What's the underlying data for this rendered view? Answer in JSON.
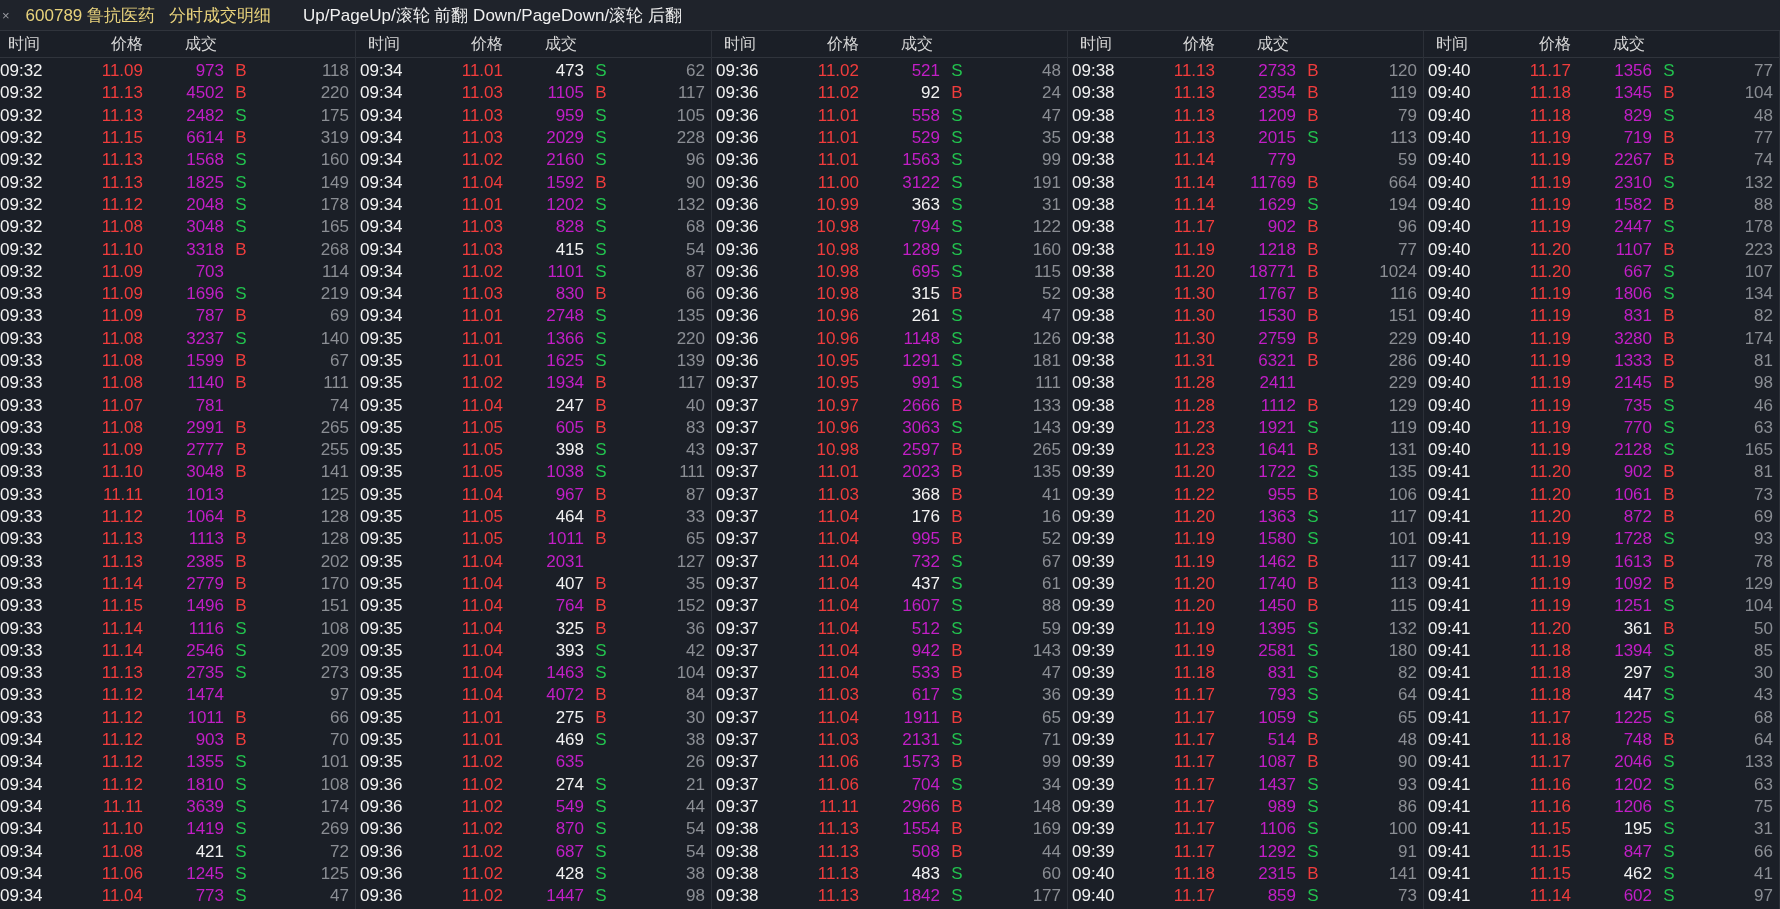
{
  "title_bar": {
    "close": "×",
    "stock": "600789 鲁抗医药",
    "view": "分时成交明细",
    "hint": "Up/PageUp/滚轮 前翻 Down/PageDown/滚轮 后翻"
  },
  "groups": [
    {
      "columns": [
        "时间",
        "价格",
        "成交"
      ],
      "rows": [
        {
          "time": "09:32",
          "price": "11.09",
          "volume": "973",
          "big": true,
          "side": "B",
          "kind": "buy",
          "count": "118"
        },
        {
          "time": "09:32",
          "price": "11.13",
          "volume": "4502",
          "big": true,
          "side": "B",
          "kind": "buy",
          "count": "220"
        },
        {
          "time": "09:32",
          "price": "11.13",
          "volume": "2482",
          "big": true,
          "side": "S",
          "kind": "sell",
          "count": "175"
        },
        {
          "time": "09:32",
          "price": "11.15",
          "volume": "6614",
          "big": true,
          "side": "B",
          "kind": "buy",
          "count": "319"
        },
        {
          "time": "09:32",
          "price": "11.13",
          "volume": "1568",
          "big": true,
          "side": "S",
          "kind": "sell",
          "count": "160"
        },
        {
          "time": "09:32",
          "price": "11.13",
          "volume": "1825",
          "big": true,
          "side": "S",
          "kind": "sell",
          "count": "149"
        },
        {
          "time": "09:32",
          "price": "11.12",
          "volume": "2048",
          "big": true,
          "side": "S",
          "kind": "sell",
          "count": "178"
        },
        {
          "time": "09:32",
          "price": "11.08",
          "volume": "3048",
          "big": true,
          "side": "S",
          "kind": "sell",
          "count": "165"
        },
        {
          "time": "09:32",
          "price": "11.10",
          "volume": "3318",
          "big": true,
          "side": "B",
          "kind": "buy",
          "count": "268"
        },
        {
          "time": "09:32",
          "price": "11.09",
          "volume": "703",
          "big": true,
          "kind": "none",
          "count": "114"
        },
        {
          "time": "09:33",
          "price": "11.09",
          "volume": "1696",
          "big": true,
          "side": "S",
          "kind": "sell",
          "count": "219"
        },
        {
          "time": "09:33",
          "price": "11.09",
          "volume": "787",
          "big": true,
          "side": "B",
          "kind": "buy",
          "count": "69"
        },
        {
          "time": "09:33",
          "price": "11.08",
          "volume": "3237",
          "big": true,
          "side": "S",
          "kind": "sell",
          "count": "140"
        },
        {
          "time": "09:33",
          "price": "11.08",
          "volume": "1599",
          "big": true,
          "side": "B",
          "kind": "buy",
          "count": "67"
        },
        {
          "time": "09:33",
          "price": "11.08",
          "volume": "1140",
          "big": true,
          "side": "B",
          "kind": "buy",
          "count": "111"
        },
        {
          "time": "09:33",
          "price": "11.07",
          "volume": "781",
          "big": true,
          "kind": "none",
          "count": "74"
        },
        {
          "time": "09:33",
          "price": "11.08",
          "volume": "2991",
          "big": true,
          "side": "B",
          "kind": "buy",
          "count": "265"
        },
        {
          "time": "09:33",
          "price": "11.09",
          "volume": "2777",
          "big": true,
          "side": "B",
          "kind": "buy",
          "count": "255"
        },
        {
          "time": "09:33",
          "price": "11.10",
          "volume": "3048",
          "big": true,
          "side": "B",
          "kind": "buy",
          "count": "141"
        },
        {
          "time": "09:33",
          "price": "11.11",
          "volume": "1013",
          "big": true,
          "kind": "none",
          "count": "125"
        },
        {
          "time": "09:33",
          "price": "11.12",
          "volume": "1064",
          "big": true,
          "side": "B",
          "kind": "buy",
          "count": "128"
        },
        {
          "time": "09:33",
          "price": "11.13",
          "volume": "1113",
          "big": true,
          "side": "B",
          "kind": "buy",
          "count": "128"
        },
        {
          "time": "09:33",
          "price": "11.13",
          "volume": "2385",
          "big": true,
          "side": "B",
          "kind": "buy",
          "count": "202"
        },
        {
          "time": "09:33",
          "price": "11.14",
          "volume": "2779",
          "big": true,
          "side": "B",
          "kind": "buy",
          "count": "170"
        },
        {
          "time": "09:33",
          "price": "11.15",
          "volume": "1496",
          "big": true,
          "side": "B",
          "kind": "buy",
          "count": "151"
        },
        {
          "time": "09:33",
          "price": "11.14",
          "volume": "1116",
          "big": true,
          "side": "S",
          "kind": "sell",
          "count": "108"
        },
        {
          "time": "09:33",
          "price": "11.14",
          "volume": "2546",
          "big": true,
          "side": "S",
          "kind": "sell",
          "count": "209"
        },
        {
          "time": "09:33",
          "price": "11.13",
          "volume": "2735",
          "big": true,
          "side": "S",
          "kind": "sell",
          "count": "273"
        },
        {
          "time": "09:33",
          "price": "11.12",
          "volume": "1474",
          "big": true,
          "kind": "none",
          "count": "97"
        },
        {
          "time": "09:33",
          "price": "11.12",
          "volume": "1011",
          "big": true,
          "side": "B",
          "kind": "buy",
          "count": "66"
        },
        {
          "time": "09:34",
          "price": "11.12",
          "volume": "903",
          "big": true,
          "side": "B",
          "kind": "buy",
          "count": "70"
        },
        {
          "time": "09:34",
          "price": "11.12",
          "volume": "1355",
          "big": true,
          "side": "S",
          "kind": "sell",
          "count": "101"
        },
        {
          "time": "09:34",
          "price": "11.12",
          "volume": "1810",
          "big": true,
          "side": "S",
          "kind": "sell",
          "count": "108"
        },
        {
          "time": "09:34",
          "price": "11.11",
          "volume": "3639",
          "big": true,
          "side": "S",
          "kind": "sell",
          "count": "174"
        },
        {
          "time": "09:34",
          "price": "11.10",
          "volume": "1419",
          "big": true,
          "side": "S",
          "kind": "sell",
          "count": "269"
        },
        {
          "time": "09:34",
          "price": "11.08",
          "volume": "421",
          "big": false,
          "side": "S",
          "kind": "sell",
          "count": "72"
        },
        {
          "time": "09:34",
          "price": "11.06",
          "volume": "1245",
          "big": true,
          "side": "S",
          "kind": "sell",
          "count": "125"
        },
        {
          "time": "09:34",
          "price": "11.04",
          "volume": "773",
          "big": true,
          "side": "S",
          "kind": "sell",
          "count": "47"
        }
      ]
    },
    {
      "columns": [
        "时间",
        "价格",
        "成交"
      ],
      "rows": [
        {
          "time": "09:34",
          "price": "11.01",
          "volume": "473",
          "big": false,
          "side": "S",
          "kind": "sell",
          "count": "62"
        },
        {
          "time": "09:34",
          "price": "11.03",
          "volume": "1105",
          "big": true,
          "side": "B",
          "kind": "buy",
          "count": "117"
        },
        {
          "time": "09:34",
          "price": "11.03",
          "volume": "959",
          "big": true,
          "side": "S",
          "kind": "sell",
          "count": "105"
        },
        {
          "time": "09:34",
          "price": "11.03",
          "volume": "2029",
          "big": true,
          "side": "S",
          "kind": "sell",
          "count": "228"
        },
        {
          "time": "09:34",
          "price": "11.02",
          "volume": "2160",
          "big": true,
          "side": "S",
          "kind": "sell",
          "count": "96"
        },
        {
          "time": "09:34",
          "price": "11.04",
          "volume": "1592",
          "big": true,
          "side": "B",
          "kind": "buy",
          "count": "90"
        },
        {
          "time": "09:34",
          "price": "11.01",
          "volume": "1202",
          "big": true,
          "side": "S",
          "kind": "sell",
          "count": "132"
        },
        {
          "time": "09:34",
          "price": "11.03",
          "volume": "828",
          "big": true,
          "side": "S",
          "kind": "sell",
          "count": "68"
        },
        {
          "time": "09:34",
          "price": "11.03",
          "volume": "415",
          "big": false,
          "side": "S",
          "kind": "sell",
          "count": "54"
        },
        {
          "time": "09:34",
          "price": "11.02",
          "volume": "1101",
          "big": true,
          "side": "S",
          "kind": "sell",
          "count": "87"
        },
        {
          "time": "09:34",
          "price": "11.03",
          "volume": "830",
          "big": true,
          "side": "B",
          "kind": "buy",
          "count": "66"
        },
        {
          "time": "09:34",
          "price": "11.01",
          "volume": "2748",
          "big": true,
          "side": "S",
          "kind": "sell",
          "count": "135"
        },
        {
          "time": "09:35",
          "price": "11.01",
          "volume": "1366",
          "big": true,
          "side": "S",
          "kind": "sell",
          "count": "220"
        },
        {
          "time": "09:35",
          "price": "11.01",
          "volume": "1625",
          "big": true,
          "side": "S",
          "kind": "sell",
          "count": "139"
        },
        {
          "time": "09:35",
          "price": "11.02",
          "volume": "1934",
          "big": true,
          "side": "B",
          "kind": "buy",
          "count": "117"
        },
        {
          "time": "09:35",
          "price": "11.04",
          "volume": "247",
          "big": false,
          "side": "B",
          "kind": "buy",
          "count": "40"
        },
        {
          "time": "09:35",
          "price": "11.05",
          "volume": "605",
          "big": true,
          "side": "B",
          "kind": "buy",
          "count": "83"
        },
        {
          "time": "09:35",
          "price": "11.05",
          "volume": "398",
          "big": false,
          "side": "S",
          "kind": "sell",
          "count": "43"
        },
        {
          "time": "09:35",
          "price": "11.05",
          "volume": "1038",
          "big": true,
          "side": "S",
          "kind": "sell",
          "count": "111"
        },
        {
          "time": "09:35",
          "price": "11.04",
          "volume": "967",
          "big": true,
          "side": "B",
          "kind": "buy",
          "count": "87"
        },
        {
          "time": "09:35",
          "price": "11.05",
          "volume": "464",
          "big": false,
          "side": "B",
          "kind": "buy",
          "count": "33"
        },
        {
          "time": "09:35",
          "price": "11.05",
          "volume": "1011",
          "big": true,
          "side": "B",
          "kind": "buy",
          "count": "65"
        },
        {
          "time": "09:35",
          "price": "11.04",
          "volume": "2031",
          "big": true,
          "kind": "none",
          "count": "127"
        },
        {
          "time": "09:35",
          "price": "11.04",
          "volume": "407",
          "big": false,
          "side": "B",
          "kind": "buy",
          "count": "35"
        },
        {
          "time": "09:35",
          "price": "11.04",
          "volume": "764",
          "big": true,
          "side": "B",
          "kind": "buy",
          "count": "152"
        },
        {
          "time": "09:35",
          "price": "11.04",
          "volume": "325",
          "big": false,
          "side": "B",
          "kind": "buy",
          "count": "36"
        },
        {
          "time": "09:35",
          "price": "11.04",
          "volume": "393",
          "big": false,
          "side": "S",
          "kind": "sell",
          "count": "42"
        },
        {
          "time": "09:35",
          "price": "11.04",
          "volume": "1463",
          "big": true,
          "side": "S",
          "kind": "sell",
          "count": "104"
        },
        {
          "time": "09:35",
          "price": "11.04",
          "volume": "4072",
          "big": true,
          "side": "B",
          "kind": "buy",
          "count": "84"
        },
        {
          "time": "09:35",
          "price": "11.01",
          "volume": "275",
          "big": false,
          "side": "B",
          "kind": "buy",
          "count": "30"
        },
        {
          "time": "09:35",
          "price": "11.01",
          "volume": "469",
          "big": false,
          "side": "S",
          "kind": "sell",
          "count": "38"
        },
        {
          "time": "09:35",
          "price": "11.02",
          "volume": "635",
          "big": true,
          "kind": "none",
          "count": "26"
        },
        {
          "time": "09:36",
          "price": "11.02",
          "volume": "274",
          "big": false,
          "side": "S",
          "kind": "sell",
          "count": "21"
        },
        {
          "time": "09:36",
          "price": "11.02",
          "volume": "549",
          "big": true,
          "side": "S",
          "kind": "sell",
          "count": "44"
        },
        {
          "time": "09:36",
          "price": "11.02",
          "volume": "870",
          "big": true,
          "side": "S",
          "kind": "sell",
          "count": "54"
        },
        {
          "time": "09:36",
          "price": "11.02",
          "volume": "687",
          "big": true,
          "side": "S",
          "kind": "sell",
          "count": "54"
        },
        {
          "time": "09:36",
          "price": "11.02",
          "volume": "428",
          "big": false,
          "side": "S",
          "kind": "sell",
          "count": "38"
        },
        {
          "time": "09:36",
          "price": "11.02",
          "volume": "1447",
          "big": true,
          "side": "S",
          "kind": "sell",
          "count": "98"
        }
      ]
    },
    {
      "columns": [
        "时间",
        "价格",
        "成交"
      ],
      "rows": [
        {
          "time": "09:36",
          "price": "11.02",
          "volume": "521",
          "big": true,
          "side": "S",
          "kind": "sell",
          "count": "48"
        },
        {
          "time": "09:36",
          "price": "11.02",
          "volume": "92",
          "big": false,
          "side": "B",
          "kind": "buy",
          "count": "24"
        },
        {
          "time": "09:36",
          "price": "11.01",
          "volume": "558",
          "big": true,
          "side": "S",
          "kind": "sell",
          "count": "47"
        },
        {
          "time": "09:36",
          "price": "11.01",
          "volume": "529",
          "big": true,
          "side": "S",
          "kind": "sell",
          "count": "35"
        },
        {
          "time": "09:36",
          "price": "11.01",
          "volume": "1563",
          "big": true,
          "side": "S",
          "kind": "sell",
          "count": "99"
        },
        {
          "time": "09:36",
          "price": "11.00",
          "volume": "3122",
          "big": true,
          "side": "S",
          "kind": "sell",
          "count": "191"
        },
        {
          "time": "09:36",
          "price": "10.99",
          "volume": "363",
          "big": false,
          "side": "S",
          "kind": "sell",
          "count": "31"
        },
        {
          "time": "09:36",
          "price": "10.98",
          "volume": "794",
          "big": true,
          "side": "S",
          "kind": "sell",
          "count": "122"
        },
        {
          "time": "09:36",
          "price": "10.98",
          "volume": "1289",
          "big": true,
          "side": "S",
          "kind": "sell",
          "count": "160"
        },
        {
          "time": "09:36",
          "price": "10.98",
          "volume": "695",
          "big": true,
          "side": "S",
          "kind": "sell",
          "count": "115"
        },
        {
          "time": "09:36",
          "price": "10.98",
          "volume": "315",
          "big": false,
          "side": "B",
          "kind": "buy",
          "count": "52"
        },
        {
          "time": "09:36",
          "price": "10.96",
          "volume": "261",
          "big": false,
          "side": "S",
          "kind": "sell",
          "count": "47"
        },
        {
          "time": "09:36",
          "price": "10.96",
          "volume": "1148",
          "big": true,
          "side": "S",
          "kind": "sell",
          "count": "126"
        },
        {
          "time": "09:36",
          "price": "10.95",
          "volume": "1291",
          "big": true,
          "side": "S",
          "kind": "sell",
          "count": "181"
        },
        {
          "time": "09:37",
          "price": "10.95",
          "volume": "991",
          "big": true,
          "side": "S",
          "kind": "sell",
          "count": "111"
        },
        {
          "time": "09:37",
          "price": "10.97",
          "volume": "2666",
          "big": true,
          "side": "B",
          "kind": "buy",
          "count": "133"
        },
        {
          "time": "09:37",
          "price": "10.96",
          "volume": "3063",
          "big": true,
          "side": "S",
          "kind": "sell",
          "count": "143"
        },
        {
          "time": "09:37",
          "price": "10.98",
          "volume": "2597",
          "big": true,
          "side": "B",
          "kind": "buy",
          "count": "265"
        },
        {
          "time": "09:37",
          "price": "11.01",
          "volume": "2023",
          "big": true,
          "side": "B",
          "kind": "buy",
          "count": "135"
        },
        {
          "time": "09:37",
          "price": "11.03",
          "volume": "368",
          "big": false,
          "side": "B",
          "kind": "buy",
          "count": "41"
        },
        {
          "time": "09:37",
          "price": "11.04",
          "volume": "176",
          "big": false,
          "side": "B",
          "kind": "buy",
          "count": "16"
        },
        {
          "time": "09:37",
          "price": "11.04",
          "volume": "995",
          "big": true,
          "side": "B",
          "kind": "buy",
          "count": "52"
        },
        {
          "time": "09:37",
          "price": "11.04",
          "volume": "732",
          "big": true,
          "side": "S",
          "kind": "sell",
          "count": "67"
        },
        {
          "time": "09:37",
          "price": "11.04",
          "volume": "437",
          "big": false,
          "side": "S",
          "kind": "sell",
          "count": "61"
        },
        {
          "time": "09:37",
          "price": "11.04",
          "volume": "1607",
          "big": true,
          "side": "S",
          "kind": "sell",
          "count": "88"
        },
        {
          "time": "09:37",
          "price": "11.04",
          "volume": "512",
          "big": true,
          "side": "S",
          "kind": "sell",
          "count": "59"
        },
        {
          "time": "09:37",
          "price": "11.04",
          "volume": "942",
          "big": true,
          "side": "B",
          "kind": "buy",
          "count": "143"
        },
        {
          "time": "09:37",
          "price": "11.04",
          "volume": "533",
          "big": true,
          "side": "B",
          "kind": "buy",
          "count": "47"
        },
        {
          "time": "09:37",
          "price": "11.03",
          "volume": "617",
          "big": true,
          "side": "S",
          "kind": "sell",
          "count": "36"
        },
        {
          "time": "09:37",
          "price": "11.04",
          "volume": "1911",
          "big": true,
          "side": "B",
          "kind": "buy",
          "count": "65"
        },
        {
          "time": "09:37",
          "price": "11.03",
          "volume": "2131",
          "big": true,
          "side": "S",
          "kind": "sell",
          "count": "71"
        },
        {
          "time": "09:37",
          "price": "11.06",
          "volume": "1573",
          "big": true,
          "side": "B",
          "kind": "buy",
          "count": "99"
        },
        {
          "time": "09:37",
          "price": "11.06",
          "volume": "704",
          "big": true,
          "side": "S",
          "kind": "sell",
          "count": "34"
        },
        {
          "time": "09:37",
          "price": "11.11",
          "volume": "2966",
          "big": true,
          "side": "B",
          "kind": "buy",
          "count": "148"
        },
        {
          "time": "09:38",
          "price": "11.13",
          "volume": "1554",
          "big": true,
          "side": "B",
          "kind": "buy",
          "count": "169"
        },
        {
          "time": "09:38",
          "price": "11.13",
          "volume": "508",
          "big": true,
          "side": "B",
          "kind": "buy",
          "count": "44"
        },
        {
          "time": "09:38",
          "price": "11.13",
          "volume": "483",
          "big": false,
          "side": "S",
          "kind": "sell",
          "count": "60"
        },
        {
          "time": "09:38",
          "price": "11.13",
          "volume": "1842",
          "big": true,
          "side": "S",
          "kind": "sell",
          "count": "177"
        }
      ]
    },
    {
      "columns": [
        "时间",
        "价格",
        "成交"
      ],
      "rows": [
        {
          "time": "09:38",
          "price": "11.13",
          "volume": "2733",
          "big": true,
          "side": "B",
          "kind": "buy",
          "count": "120"
        },
        {
          "time": "09:38",
          "price": "11.13",
          "volume": "2354",
          "big": true,
          "side": "B",
          "kind": "buy",
          "count": "119"
        },
        {
          "time": "09:38",
          "price": "11.13",
          "volume": "1209",
          "big": true,
          "side": "B",
          "kind": "buy",
          "count": "79"
        },
        {
          "time": "09:38",
          "price": "11.13",
          "volume": "2015",
          "big": true,
          "side": "S",
          "kind": "sell",
          "count": "113"
        },
        {
          "time": "09:38",
          "price": "11.14",
          "volume": "779",
          "big": true,
          "kind": "none",
          "count": "59"
        },
        {
          "time": "09:38",
          "price": "11.14",
          "volume": "11769",
          "big": true,
          "side": "B",
          "kind": "buy",
          "count": "664"
        },
        {
          "time": "09:38",
          "price": "11.14",
          "volume": "1629",
          "big": true,
          "side": "S",
          "kind": "sell",
          "count": "194"
        },
        {
          "time": "09:38",
          "price": "11.17",
          "volume": "902",
          "big": true,
          "side": "B",
          "kind": "buy",
          "count": "96"
        },
        {
          "time": "09:38",
          "price": "11.19",
          "volume": "1218",
          "big": true,
          "side": "B",
          "kind": "buy",
          "count": "77"
        },
        {
          "time": "09:38",
          "price": "11.20",
          "volume": "18771",
          "big": true,
          "side": "B",
          "kind": "buy",
          "count": "1024"
        },
        {
          "time": "09:38",
          "price": "11.30",
          "volume": "1767",
          "big": true,
          "side": "B",
          "kind": "buy",
          "count": "116"
        },
        {
          "time": "09:38",
          "price": "11.30",
          "volume": "1530",
          "big": true,
          "side": "B",
          "kind": "buy",
          "count": "151"
        },
        {
          "time": "09:38",
          "price": "11.30",
          "volume": "2759",
          "big": true,
          "side": "B",
          "kind": "buy",
          "count": "229"
        },
        {
          "time": "09:38",
          "price": "11.31",
          "volume": "6321",
          "big": true,
          "side": "B",
          "kind": "buy",
          "count": "286"
        },
        {
          "time": "09:38",
          "price": "11.28",
          "volume": "2411",
          "big": true,
          "kind": "none",
          "count": "229"
        },
        {
          "time": "09:38",
          "price": "11.28",
          "volume": "1112",
          "big": true,
          "side": "B",
          "kind": "buy",
          "count": "129"
        },
        {
          "time": "09:39",
          "price": "11.23",
          "volume": "1921",
          "big": true,
          "side": "S",
          "kind": "sell",
          "count": "119"
        },
        {
          "time": "09:39",
          "price": "11.23",
          "volume": "1641",
          "big": true,
          "side": "B",
          "kind": "buy",
          "count": "131"
        },
        {
          "time": "09:39",
          "price": "11.20",
          "volume": "1722",
          "big": true,
          "side": "S",
          "kind": "sell",
          "count": "135"
        },
        {
          "time": "09:39",
          "price": "11.22",
          "volume": "955",
          "big": true,
          "side": "B",
          "kind": "buy",
          "count": "106"
        },
        {
          "time": "09:39",
          "price": "11.20",
          "volume": "1363",
          "big": true,
          "side": "S",
          "kind": "sell",
          "count": "117"
        },
        {
          "time": "09:39",
          "price": "11.19",
          "volume": "1580",
          "big": true,
          "side": "S",
          "kind": "sell",
          "count": "101"
        },
        {
          "time": "09:39",
          "price": "11.19",
          "volume": "1462",
          "big": true,
          "side": "B",
          "kind": "buy",
          "count": "117"
        },
        {
          "time": "09:39",
          "price": "11.20",
          "volume": "1740",
          "big": true,
          "side": "B",
          "kind": "buy",
          "count": "113"
        },
        {
          "time": "09:39",
          "price": "11.20",
          "volume": "1450",
          "big": true,
          "side": "B",
          "kind": "buy",
          "count": "115"
        },
        {
          "time": "09:39",
          "price": "11.19",
          "volume": "1395",
          "big": true,
          "side": "S",
          "kind": "sell",
          "count": "132"
        },
        {
          "time": "09:39",
          "price": "11.19",
          "volume": "2581",
          "big": true,
          "side": "S",
          "kind": "sell",
          "count": "180"
        },
        {
          "time": "09:39",
          "price": "11.18",
          "volume": "831",
          "big": true,
          "side": "S",
          "kind": "sell",
          "count": "82"
        },
        {
          "time": "09:39",
          "price": "11.17",
          "volume": "793",
          "big": true,
          "side": "S",
          "kind": "sell",
          "count": "64"
        },
        {
          "time": "09:39",
          "price": "11.17",
          "volume": "1059",
          "big": true,
          "side": "S",
          "kind": "sell",
          "count": "65"
        },
        {
          "time": "09:39",
          "price": "11.17",
          "volume": "514",
          "big": true,
          "side": "B",
          "kind": "buy",
          "count": "48"
        },
        {
          "time": "09:39",
          "price": "11.17",
          "volume": "1087",
          "big": true,
          "side": "B",
          "kind": "buy",
          "count": "90"
        },
        {
          "time": "09:39",
          "price": "11.17",
          "volume": "1437",
          "big": true,
          "side": "S",
          "kind": "sell",
          "count": "93"
        },
        {
          "time": "09:39",
          "price": "11.17",
          "volume": "989",
          "big": true,
          "side": "S",
          "kind": "sell",
          "count": "86"
        },
        {
          "time": "09:39",
          "price": "11.17",
          "volume": "1106",
          "big": true,
          "side": "S",
          "kind": "sell",
          "count": "100"
        },
        {
          "time": "09:39",
          "price": "11.17",
          "volume": "1292",
          "big": true,
          "side": "S",
          "kind": "sell",
          "count": "91"
        },
        {
          "time": "09:40",
          "price": "11.18",
          "volume": "2315",
          "big": true,
          "side": "B",
          "kind": "buy",
          "count": "141"
        },
        {
          "time": "09:40",
          "price": "11.17",
          "volume": "859",
          "big": true,
          "side": "S",
          "kind": "sell",
          "count": "73"
        }
      ]
    },
    {
      "columns": [
        "时间",
        "价格",
        "成交"
      ],
      "rows": [
        {
          "time": "09:40",
          "price": "11.17",
          "volume": "1356",
          "big": true,
          "side": "S",
          "kind": "sell",
          "count": "77"
        },
        {
          "time": "09:40",
          "price": "11.18",
          "volume": "1345",
          "big": true,
          "side": "B",
          "kind": "buy",
          "count": "104"
        },
        {
          "time": "09:40",
          "price": "11.18",
          "volume": "829",
          "big": true,
          "side": "S",
          "kind": "sell",
          "count": "48"
        },
        {
          "time": "09:40",
          "price": "11.19",
          "volume": "719",
          "big": true,
          "side": "B",
          "kind": "buy",
          "count": "77"
        },
        {
          "time": "09:40",
          "price": "11.19",
          "volume": "2267",
          "big": true,
          "side": "B",
          "kind": "buy",
          "count": "74"
        },
        {
          "time": "09:40",
          "price": "11.19",
          "volume": "2310",
          "big": true,
          "side": "S",
          "kind": "sell",
          "count": "132"
        },
        {
          "time": "09:40",
          "price": "11.19",
          "volume": "1582",
          "big": true,
          "side": "B",
          "kind": "buy",
          "count": "88"
        },
        {
          "time": "09:40",
          "price": "11.19",
          "volume": "2447",
          "big": true,
          "side": "S",
          "kind": "sell",
          "count": "178"
        },
        {
          "time": "09:40",
          "price": "11.20",
          "volume": "1107",
          "big": true,
          "side": "B",
          "kind": "buy",
          "count": "223"
        },
        {
          "time": "09:40",
          "price": "11.20",
          "volume": "667",
          "big": true,
          "side": "S",
          "kind": "sell",
          "count": "107"
        },
        {
          "time": "09:40",
          "price": "11.19",
          "volume": "1806",
          "big": true,
          "side": "S",
          "kind": "sell",
          "count": "134"
        },
        {
          "time": "09:40",
          "price": "11.19",
          "volume": "831",
          "big": true,
          "side": "B",
          "kind": "buy",
          "count": "82"
        },
        {
          "time": "09:40",
          "price": "11.19",
          "volume": "3280",
          "big": true,
          "side": "B",
          "kind": "buy",
          "count": "174"
        },
        {
          "time": "09:40",
          "price": "11.19",
          "volume": "1333",
          "big": true,
          "side": "B",
          "kind": "buy",
          "count": "81"
        },
        {
          "time": "09:40",
          "price": "11.19",
          "volume": "2145",
          "big": true,
          "side": "B",
          "kind": "buy",
          "count": "98"
        },
        {
          "time": "09:40",
          "price": "11.19",
          "volume": "735",
          "big": true,
          "side": "S",
          "kind": "sell",
          "count": "46"
        },
        {
          "time": "09:40",
          "price": "11.19",
          "volume": "770",
          "big": true,
          "side": "S",
          "kind": "sell",
          "count": "63"
        },
        {
          "time": "09:40",
          "price": "11.19",
          "volume": "2128",
          "big": true,
          "side": "S",
          "kind": "sell",
          "count": "165"
        },
        {
          "time": "09:41",
          "price": "11.20",
          "volume": "902",
          "big": true,
          "side": "B",
          "kind": "buy",
          "count": "81"
        },
        {
          "time": "09:41",
          "price": "11.20",
          "volume": "1061",
          "big": true,
          "side": "B",
          "kind": "buy",
          "count": "73"
        },
        {
          "time": "09:41",
          "price": "11.20",
          "volume": "872",
          "big": true,
          "side": "B",
          "kind": "buy",
          "count": "69"
        },
        {
          "time": "09:41",
          "price": "11.19",
          "volume": "1728",
          "big": true,
          "side": "S",
          "kind": "sell",
          "count": "93"
        },
        {
          "time": "09:41",
          "price": "11.19",
          "volume": "1613",
          "big": true,
          "side": "B",
          "kind": "buy",
          "count": "78"
        },
        {
          "time": "09:41",
          "price": "11.19",
          "volume": "1092",
          "big": true,
          "side": "B",
          "kind": "buy",
          "count": "129"
        },
        {
          "time": "09:41",
          "price": "11.19",
          "volume": "1251",
          "big": true,
          "side": "S",
          "kind": "sell",
          "count": "104"
        },
        {
          "time": "09:41",
          "price": "11.20",
          "volume": "361",
          "big": false,
          "side": "B",
          "kind": "buy",
          "count": "50"
        },
        {
          "time": "09:41",
          "price": "11.18",
          "volume": "1394",
          "big": true,
          "side": "S",
          "kind": "sell",
          "count": "85"
        },
        {
          "time": "09:41",
          "price": "11.18",
          "volume": "297",
          "big": false,
          "side": "S",
          "kind": "sell",
          "count": "30"
        },
        {
          "time": "09:41",
          "price": "11.18",
          "volume": "447",
          "big": false,
          "side": "S",
          "kind": "sell",
          "count": "43"
        },
        {
          "time": "09:41",
          "price": "11.17",
          "volume": "1225",
          "big": true,
          "side": "S",
          "kind": "sell",
          "count": "68"
        },
        {
          "time": "09:41",
          "price": "11.18",
          "volume": "748",
          "big": true,
          "side": "B",
          "kind": "buy",
          "count": "64"
        },
        {
          "time": "09:41",
          "price": "11.17",
          "volume": "2046",
          "big": true,
          "side": "S",
          "kind": "sell",
          "count": "133"
        },
        {
          "time": "09:41",
          "price": "11.16",
          "volume": "1202",
          "big": true,
          "side": "S",
          "kind": "sell",
          "count": "63"
        },
        {
          "time": "09:41",
          "price": "11.16",
          "volume": "1206",
          "big": true,
          "side": "S",
          "kind": "sell",
          "count": "75"
        },
        {
          "time": "09:41",
          "price": "11.15",
          "volume": "195",
          "big": false,
          "side": "S",
          "kind": "sell",
          "count": "31"
        },
        {
          "time": "09:41",
          "price": "11.15",
          "volume": "847",
          "big": true,
          "side": "S",
          "kind": "sell",
          "count": "66"
        },
        {
          "time": "09:41",
          "price": "11.15",
          "volume": "462",
          "big": false,
          "side": "S",
          "kind": "sell",
          "count": "41"
        },
        {
          "time": "09:41",
          "price": "11.14",
          "volume": "602",
          "big": true,
          "side": "S",
          "kind": "sell",
          "count": "97"
        }
      ]
    }
  ]
}
